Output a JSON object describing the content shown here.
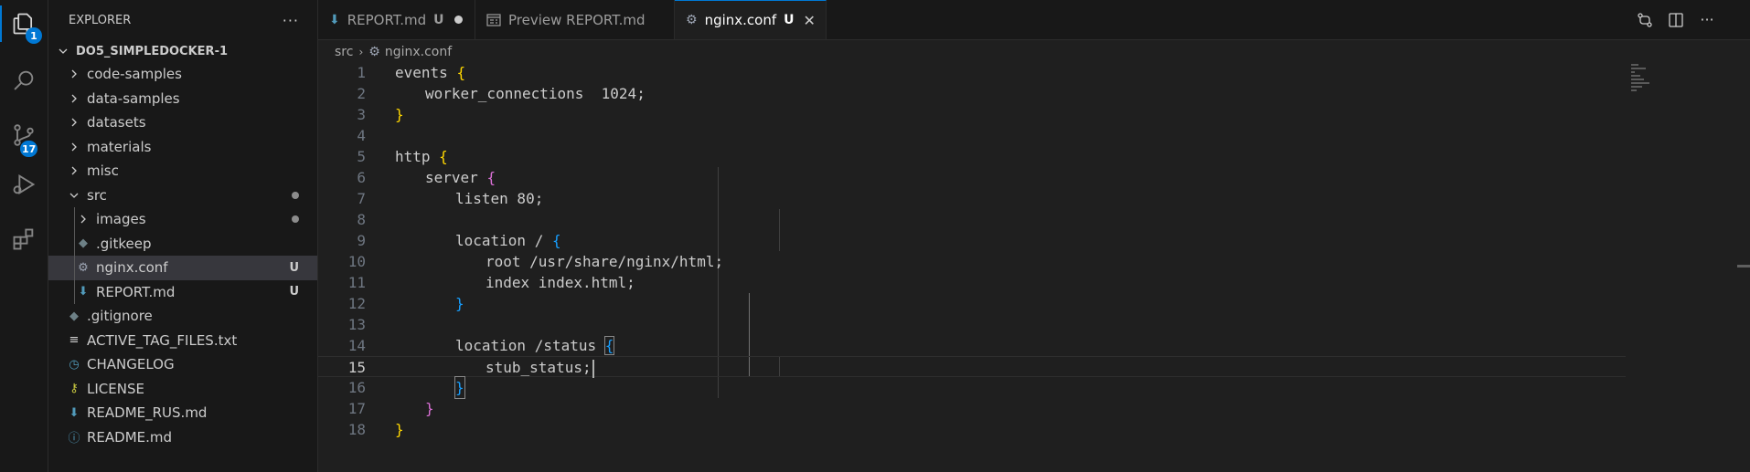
{
  "activity_bar": {
    "explorer_badge": "1",
    "scm_badge": "17"
  },
  "sidebar": {
    "title": "EXPLORER",
    "more_label": "···",
    "root": "DO5_SIMPLEDOCKER-1",
    "items": [
      {
        "label": "code-samples",
        "kind": "folder"
      },
      {
        "label": "data-samples",
        "kind": "folder"
      },
      {
        "label": "datasets",
        "kind": "folder"
      },
      {
        "label": "materials",
        "kind": "folder"
      },
      {
        "label": "misc",
        "kind": "folder"
      },
      {
        "label": "src",
        "kind": "folder-open"
      },
      {
        "label": "images",
        "kind": "folder"
      },
      {
        "label": ".gitkeep",
        "kind": "git"
      },
      {
        "label": "nginx.conf",
        "kind": "gear",
        "badge": "U"
      },
      {
        "label": "REPORT.md",
        "kind": "markdown",
        "badge": "U"
      },
      {
        "label": ".gitignore",
        "kind": "git"
      },
      {
        "label": "ACTIVE_TAG_FILES.txt",
        "kind": "text"
      },
      {
        "label": "CHANGELOG",
        "kind": "clock"
      },
      {
        "label": "LICENSE",
        "kind": "license"
      },
      {
        "label": "README_RUS.md",
        "kind": "markdown"
      },
      {
        "label": "README.md",
        "kind": "info"
      }
    ]
  },
  "tabs": [
    {
      "label": "REPORT.md",
      "flag": "U",
      "modified": true
    },
    {
      "label": "Preview REPORT.md"
    },
    {
      "label": "nginx.conf",
      "flag": "U",
      "close": "✕",
      "active": true
    }
  ],
  "breadcrumb": {
    "folder": "src",
    "file": "nginx.conf"
  },
  "editor": {
    "current_line": 15,
    "lines": [
      {
        "n": "1",
        "text": "events "
      },
      {
        "n": "2",
        "text": "worker_connections  1024;"
      },
      {
        "n": "3",
        "text": ""
      },
      {
        "n": "4",
        "text": ""
      },
      {
        "n": "5",
        "text": "http "
      },
      {
        "n": "6",
        "text": "server "
      },
      {
        "n": "7",
        "text": "listen 80;"
      },
      {
        "n": "8",
        "text": ""
      },
      {
        "n": "9",
        "text": "location / "
      },
      {
        "n": "10",
        "text": "root /usr/share/nginx/html;"
      },
      {
        "n": "11",
        "text": "index index.html;"
      },
      {
        "n": "12",
        "text": ""
      },
      {
        "n": "13",
        "text": ""
      },
      {
        "n": "14",
        "text": "location /status "
      },
      {
        "n": "15",
        "text": "stub_status;"
      },
      {
        "n": "16",
        "text": ""
      },
      {
        "n": "17",
        "text": ""
      },
      {
        "n": "18",
        "text": ""
      }
    ],
    "brackets": {
      "open_yellow": "{",
      "close_yellow": "}",
      "open_purple": "{",
      "close_purple": "}",
      "open_blue": "{",
      "close_blue": "}"
    }
  },
  "colors": {
    "accent": "#0078d4",
    "bracket_level1": "#ffd700",
    "bracket_level2": "#da70d6",
    "bracket_level3": "#179fff"
  }
}
